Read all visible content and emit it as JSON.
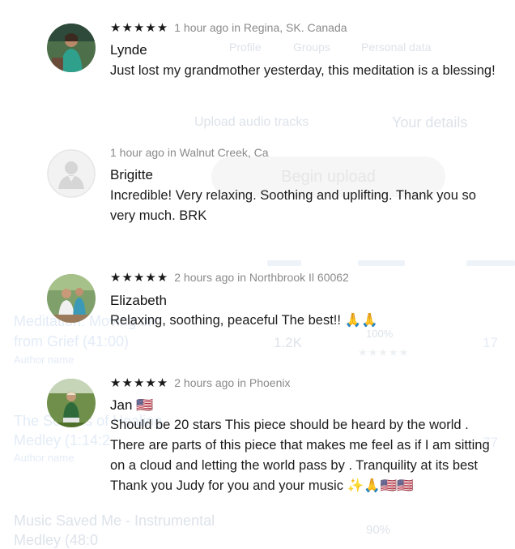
{
  "background_page": {
    "tabs": [
      "Profile",
      "Groups",
      "Personal data"
    ],
    "upload_links": [
      "Upload audio tracks",
      "Your details"
    ],
    "upload_button": "Begin upload",
    "tracks": [
      {
        "title": "Meditation: Moving on",
        "subtitle": "from Grief (41:00)",
        "author": "Author name",
        "plays": "1.2K",
        "percent": "100%",
        "count": "17"
      },
      {
        "title": "The Sounds of Healing",
        "subtitle": "Medley (1:14:2",
        "author": "Author name",
        "count": "77"
      },
      {
        "title": "Music Saved Me - Instrumental",
        "subtitle": "Medley (48:0",
        "percent": "90%"
      }
    ]
  },
  "reviews": [
    {
      "rating": 5,
      "stars": "★★★★★",
      "time": "1 hour ago in Regina, SK. Canada",
      "name": "Lynde",
      "text": "Just lost my grandmother yesterday, this meditation is a blessing!",
      "avatar": "photo-avatar"
    },
    {
      "rating": 0,
      "stars": "",
      "time": "1 hour ago in Walnut Creek, Ca",
      "name": "Brigitte",
      "text": "Incredible! Very relaxing. Soothing and uplifting. Thank you so very much. BRK",
      "avatar": "default-avatar"
    },
    {
      "rating": 5,
      "stars": "★★★★★",
      "time": "2 hours ago in Northbrook Il 60062",
      "name": "Elizabeth",
      "text": "Relaxing, soothing, peaceful The best!! 🙏🙏",
      "avatar": "photo-avatar"
    },
    {
      "rating": 5,
      "stars": "★★★★★",
      "time": "2 hours ago in Phoenix",
      "name": "Jan 🇺🇸",
      "text": "Should be 20 stars This piece should be heard by the world . There are parts of this piece that makes me feel as if I am sitting on a cloud and letting the world pass by . Tranquility at its best Thank you Judy for you and your music ✨🙏🇺🇸🇺🇸",
      "avatar": "photo-avatar"
    }
  ]
}
